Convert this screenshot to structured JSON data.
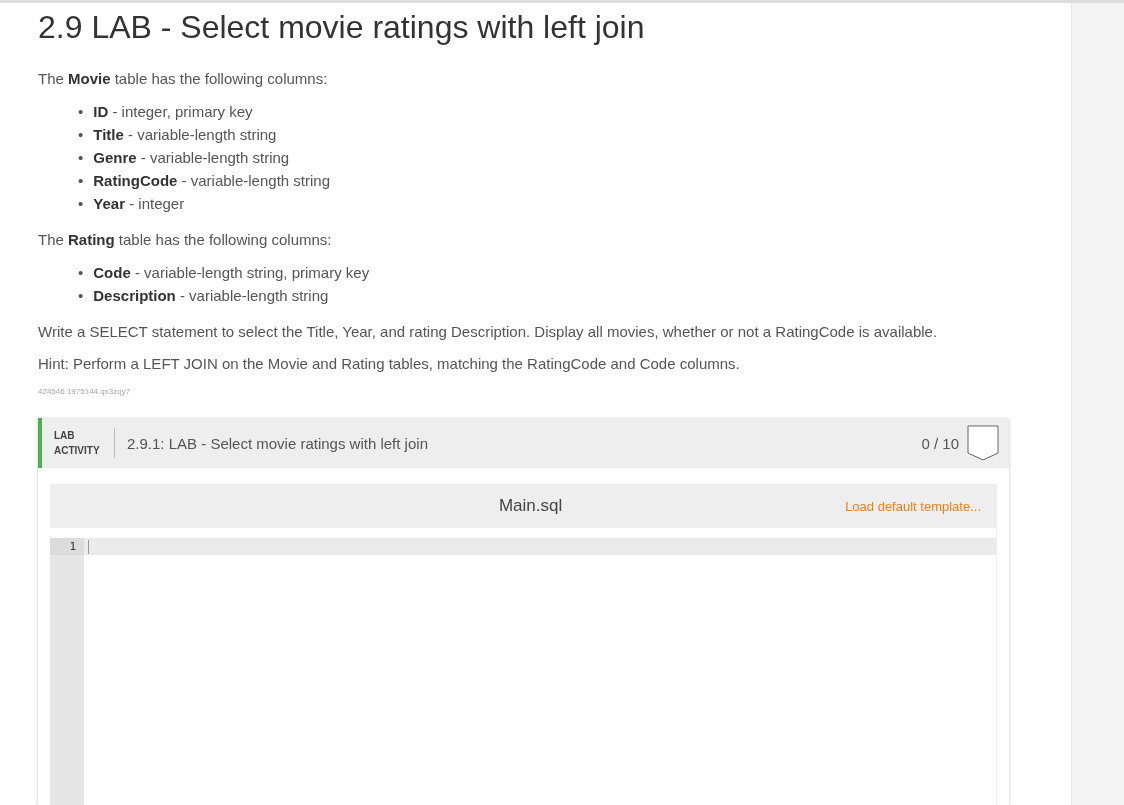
{
  "title": "2.9 LAB - Select movie ratings with left join",
  "sections": [
    {
      "intro": "The **Movie** table has the following columns:",
      "marker": "•",
      "items": [
        "**ID** - integer, primary key",
        "**Title** - variable-length string",
        "**Genre** - variable-length string",
        "**RatingCode** - variable-length string",
        "**Year** - integer"
      ]
    },
    {
      "intro": "The **Rating** table has the following columns:",
      "marker": "•",
      "items": [
        "**Code** - variable-length string, primary key",
        "**Description** - variable-length string"
      ]
    }
  ],
  "paragraphs": [
    "Write a SELECT statement to select the Title, Year, and rating Description. Display all movies, whether or not a RatingCode is available.",
    "Hint: Perform a LEFT JOIN on the Movie and Rating tables, matching the RatingCode and Code columns."
  ],
  "content_id": "424546.1975144.qx3zqy7",
  "activity": {
    "label": "LAB ACTIVITY",
    "title": "2.9.1: LAB - Select movie ratings with left join",
    "score": "0 / 10",
    "completed": false
  },
  "editor": {
    "filename": "Main.sql",
    "load_link": "Load default template...",
    "line_numbers": [
      "1"
    ]
  }
}
